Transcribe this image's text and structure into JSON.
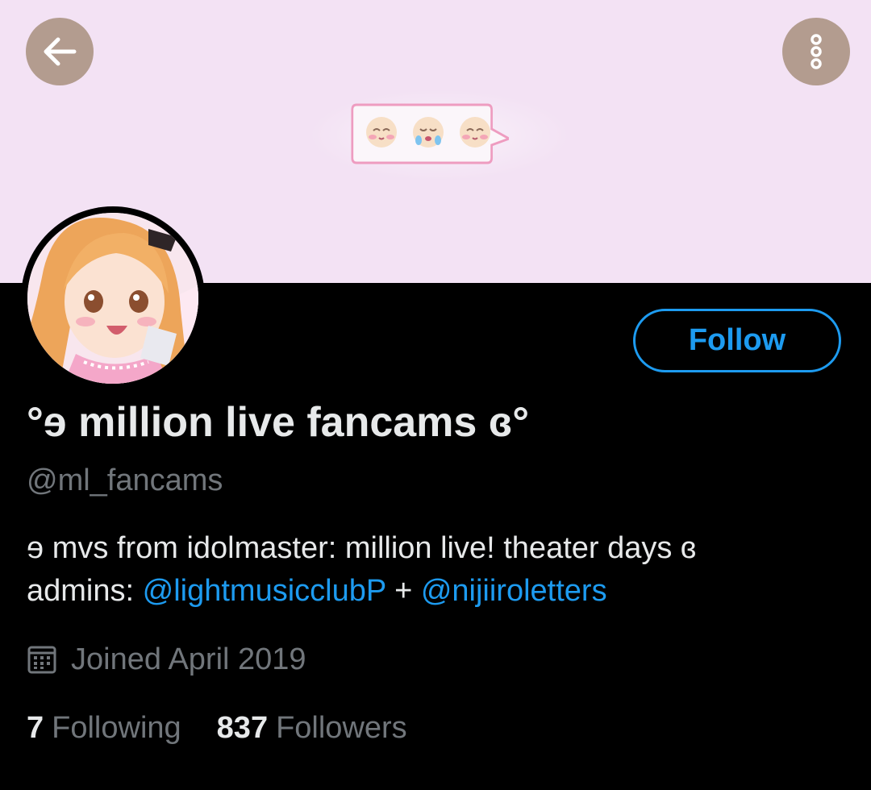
{
  "profile": {
    "display_name": "°ɘ million live fancams ɞ°",
    "handle": "@ml_fancams",
    "bio": {
      "line1": "ɘ mvs from idolmaster: million live! theater days ɞ",
      "line2_prefix": "admins: ",
      "admin1": "@lightmusicclubP",
      "separator": " + ",
      "admin2": "@nijiiroletters"
    },
    "joined": "Joined April 2019",
    "following_count": "7",
    "following_label": "Following",
    "followers_count": "837",
    "followers_label": "Followers"
  },
  "actions": {
    "follow_label": "Follow"
  },
  "icons": {
    "back": "arrow-left-icon",
    "more": "more-vertical-icon",
    "calendar": "calendar-icon"
  },
  "colors": {
    "accent": "#1d9bf0",
    "banner_bg": "#f3e2f4",
    "circle_button": "#b39c8f",
    "secondary_text": "#71767b",
    "primary_text": "#e7e9ea",
    "background": "#000000"
  }
}
